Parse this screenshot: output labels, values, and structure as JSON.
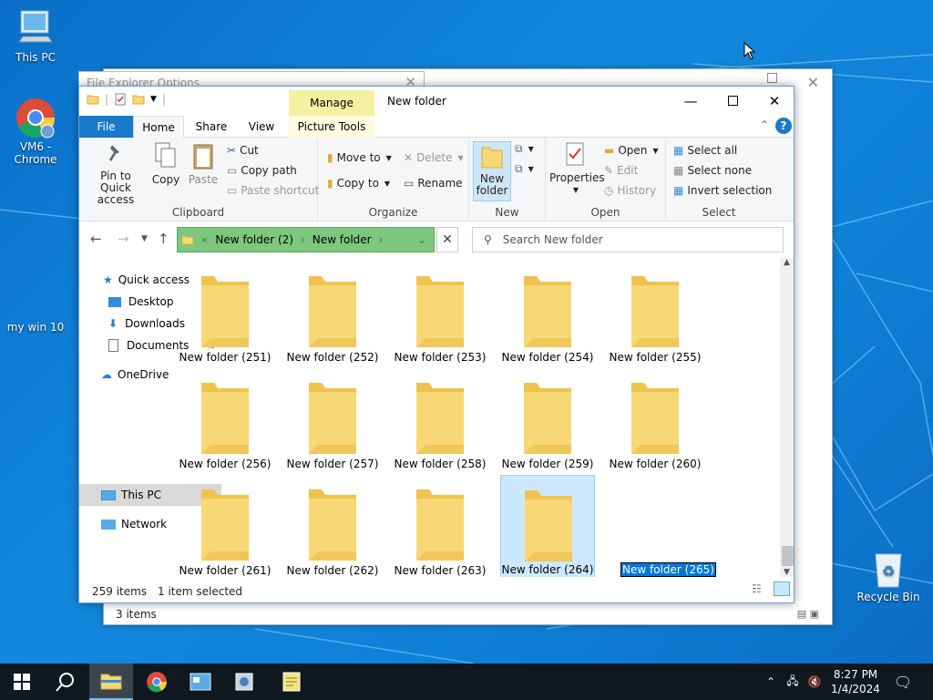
{
  "desktop": {
    "icons": [
      {
        "label": "This PC"
      },
      {
        "label": "VM6 - Chrome"
      },
      {
        "label": "my win 10"
      },
      {
        "label": "Recycle Bin"
      }
    ]
  },
  "background_window": {
    "title": "File Explorer Options",
    "status": "3 items"
  },
  "window": {
    "title": "New folder",
    "manage_label": "Manage",
    "tabs": [
      "File",
      "Home",
      "Share",
      "View",
      "Picture Tools"
    ],
    "ribbon": {
      "clipboard": {
        "label": "Clipboard",
        "pin": "Pin to Quick access",
        "copy": "Copy",
        "paste": "Paste",
        "cut": "Cut",
        "copy_path": "Copy path",
        "paste_shortcut": "Paste shortcut"
      },
      "organize": {
        "label": "Organize",
        "move_to": "Move to",
        "copy_to": "Copy to",
        "delete": "Delete",
        "rename": "Rename"
      },
      "new": {
        "label": "New",
        "new_folder": "New folder"
      },
      "open": {
        "label": "Open",
        "properties": "Properties",
        "open": "Open",
        "edit": "Edit",
        "history": "History"
      },
      "select": {
        "label": "Select",
        "select_all": "Select all",
        "select_none": "Select none",
        "invert": "Invert selection"
      }
    },
    "address": {
      "crumbs": [
        "New folder (2)",
        "New folder"
      ]
    },
    "search": {
      "placeholder": "Search New folder"
    },
    "nav": {
      "quick_access": "Quick access",
      "desktop": "Desktop",
      "downloads": "Downloads",
      "documents": "Documents",
      "onedrive": "OneDrive",
      "this_pc": "This PC",
      "network": "Network"
    },
    "folders": [
      "New folder (251)",
      "New folder (252)",
      "New folder (253)",
      "New folder (254)",
      "New folder (255)",
      "New folder (256)",
      "New folder (257)",
      "New folder (258)",
      "New folder (259)",
      "New folder (260)",
      "New folder (261)",
      "New folder (262)",
      "New folder (263)",
      "New folder (264)",
      "New folder (265)"
    ],
    "status": {
      "count": "259 items",
      "selected": "1 item selected"
    }
  },
  "taskbar": {
    "time": "8:27 PM",
    "date": "1/4/2024"
  },
  "colors": {
    "accent": "#1979ca",
    "folder": "#f8d775",
    "selection": "#cce8ff"
  }
}
